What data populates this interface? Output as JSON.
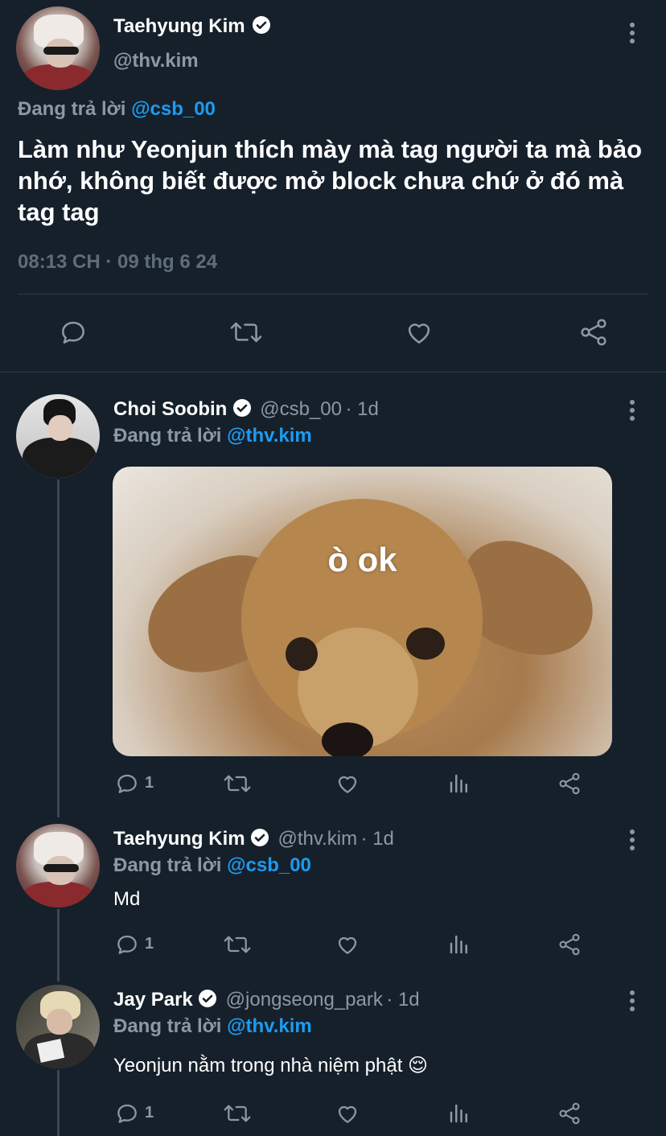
{
  "main_tweet": {
    "author_name": "Taehyung Kim",
    "author_handle": "@thv.kim",
    "reply_prefix": "Đang trả lời",
    "reply_to": "@csb_00",
    "text": "Làm như Yeonjun thích mày mà tag người ta mà bảo nhớ, không biết được mở block chưa chứ ở đó mà tag tag",
    "timestamp": "08:13 CH · 09 thg 6 24"
  },
  "replies": [
    {
      "author_name": "Choi Soobin",
      "author_handle": "@csb_00",
      "age": "· 1d",
      "reply_prefix": "Đang trả lời",
      "reply_to": "@thv.kim",
      "media_caption": "ò ok",
      "reply_count": "1"
    },
    {
      "author_name": "Taehyung Kim",
      "author_handle": "@thv.kim",
      "age": "· 1d",
      "reply_prefix": "Đang trả lời",
      "reply_to": "@csb_00",
      "text": "Md",
      "reply_count": "1"
    },
    {
      "author_name": "Jay Park",
      "author_handle": "@jongseong_park",
      "age": "· 1d",
      "reply_prefix": "Đang trả lời",
      "reply_to": "@thv.kim",
      "text": "Yeonjun nằm trong nhà niệm phật 😌",
      "reply_count": "1"
    }
  ],
  "colors": {
    "background": "#15202b",
    "secondary_text": "#8b98a5",
    "accent": "#1d9bf0",
    "divider": "#2f3b47"
  },
  "icons": [
    "reply-icon",
    "retweet-icon",
    "like-icon",
    "share-icon",
    "views-icon",
    "more-icon",
    "verified-icon"
  ]
}
